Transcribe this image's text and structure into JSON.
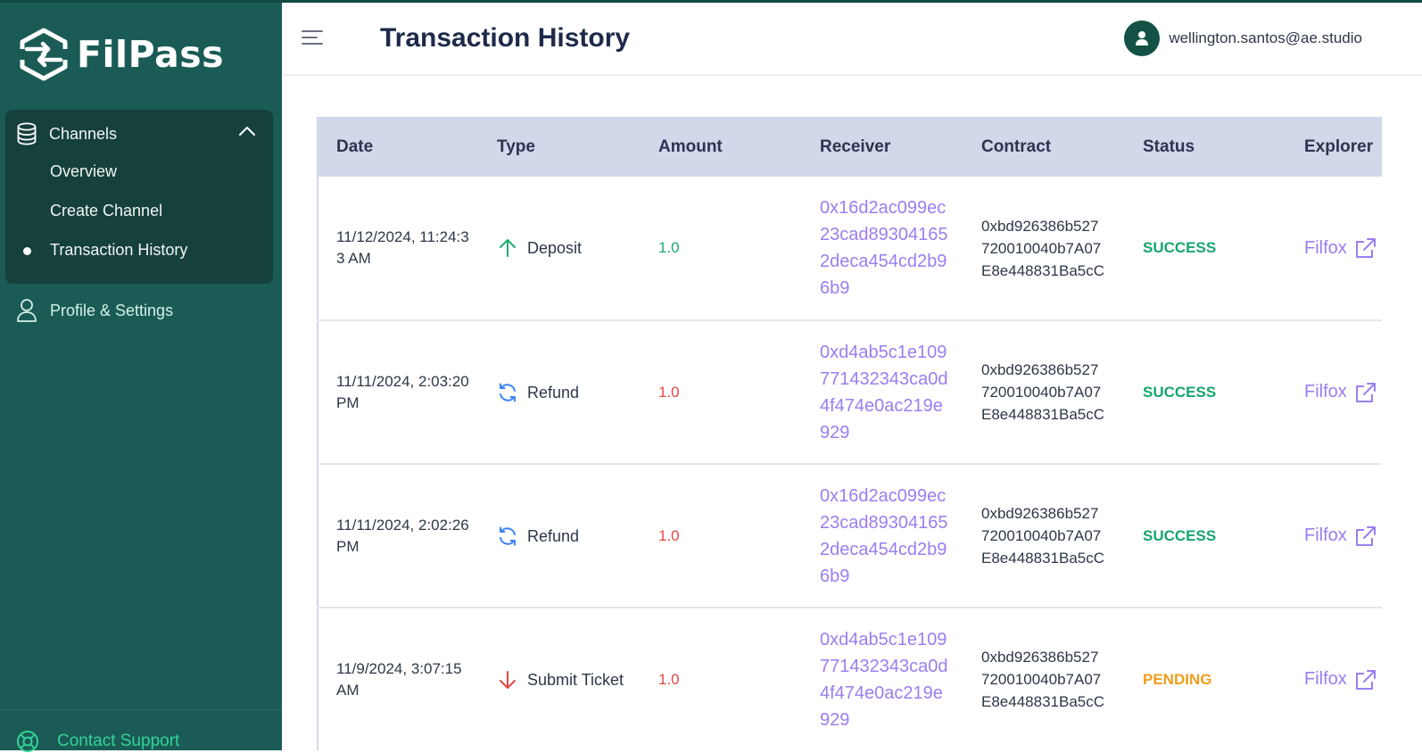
{
  "app": {
    "name": "FilPass"
  },
  "sidebar": {
    "group": {
      "label": "Channels",
      "icon": "database-icon"
    },
    "sub_items": [
      {
        "label": "Overview",
        "active": false
      },
      {
        "label": "Create Channel",
        "active": false
      },
      {
        "label": "Transaction History",
        "active": true
      }
    ],
    "profile": {
      "label": "Profile & Settings",
      "icon": "user-icon"
    },
    "support": {
      "label": "Contact Support",
      "icon": "lifebuoy-icon"
    }
  },
  "header": {
    "title": "Transaction History",
    "user_email": "wellington.santos@ae.studio"
  },
  "table": {
    "columns": [
      "Date",
      "Type",
      "Amount",
      "Receiver",
      "Contract",
      "Status",
      "Explorer"
    ],
    "rows": [
      {
        "date": "11/12/2024, 11:24:33 AM",
        "type": "Deposit",
        "type_icon": "arrow-up-icon",
        "amount": "1.0",
        "receiver": "0x16d2ac099ec23cad893041652deca454cd2b96b9",
        "contract": "0xbd926386b527720010040b7A07E8e448831Ba5cC",
        "status": "SUCCESS",
        "explorer": "Filfox"
      },
      {
        "date": "11/11/2024, 2:03:20 PM",
        "type": "Refund",
        "type_icon": "refresh-icon",
        "amount": "1.0",
        "receiver": "0xd4ab5c1e109771432343ca0d4f474e0ac219e929",
        "contract": "0xbd926386b527720010040b7A07E8e448831Ba5cC",
        "status": "SUCCESS",
        "explorer": "Filfox"
      },
      {
        "date": "11/11/2024, 2:02:26 PM",
        "type": "Refund",
        "type_icon": "refresh-icon",
        "amount": "1.0",
        "receiver": "0x16d2ac099ec23cad893041652deca454cd2b96b9",
        "contract": "0xbd926386b527720010040b7A07E8e448831Ba5cC",
        "status": "SUCCESS",
        "explorer": "Filfox"
      },
      {
        "date": "11/9/2024, 3:07:15 AM",
        "type": "Submit Ticket",
        "type_icon": "arrow-down-icon",
        "amount": "1.0",
        "receiver": "0xd4ab5c1e109771432343ca0d4f474e0ac219e929",
        "contract": "0xbd926386b527720010040b7A07E8e448831Ba5cC",
        "status": "PENDING",
        "explorer": "Filfox"
      }
    ]
  },
  "colors": {
    "sidebar_bg": "#1a5c55",
    "nav_group_bg": "#15403b",
    "header_row_bg": "#d2d7ea",
    "link": "#9b7df0",
    "success": "#16a56d",
    "pending": "#ef9d1a",
    "amount_in": "#1fa971",
    "amount_out": "#e04848"
  }
}
